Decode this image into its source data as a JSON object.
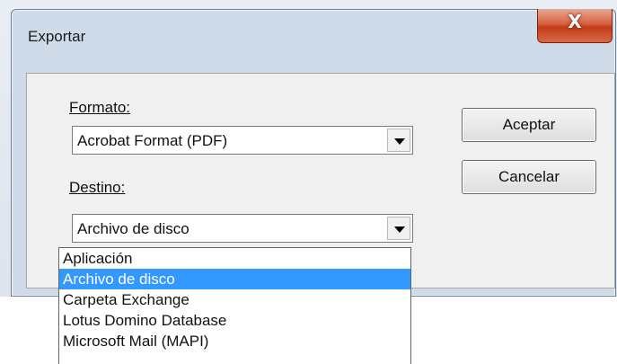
{
  "dialog": {
    "title": "Exportar",
    "close_glyph": "X"
  },
  "format": {
    "label": "Formato:",
    "selected": "Acrobat Format (PDF)"
  },
  "destination": {
    "label": "Destino:",
    "selected": "Archivo de disco",
    "options": [
      "Aplicación",
      "Archivo de disco",
      "Carpeta Exchange",
      "Lotus Domino Database",
      "Microsoft Mail (MAPI)"
    ],
    "highlighted_option": "Archivo de disco"
  },
  "buttons": {
    "ok": "Aceptar",
    "cancel": "Cancelar"
  },
  "icons": [
    "close-icon",
    "dropdown-arrow-icon"
  ]
}
